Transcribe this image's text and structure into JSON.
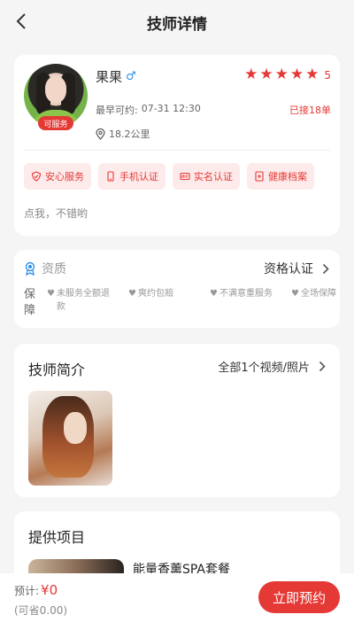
{
  "header": {
    "title": "技师详情"
  },
  "profile": {
    "name": "果果",
    "gender_symbol": "♂",
    "rating": 5,
    "rating_label": "5",
    "service_tag": "可服务",
    "available_label": "最早可约:",
    "available_time": "07-31 12:30",
    "served": "已接18单",
    "distance": "18.2公里",
    "badges": [
      "安心服务",
      "手机认证",
      "实名认证",
      "健康档案"
    ],
    "tagline": "点我，不错哟"
  },
  "qualification": {
    "title": "资质",
    "cert": "资格认证",
    "guarantee_label": "保障",
    "guarantees": [
      "未服务全额退款",
      "爽约包赔",
      "不满意重服务",
      "全场保障"
    ]
  },
  "intro": {
    "title": "技师简介",
    "more": "全部1个视频/照片"
  },
  "items": {
    "title": "提供项目",
    "first_item": "能量香薰SPA套餐"
  },
  "bottom": {
    "total_label": "预计:",
    "total_price": "¥0",
    "saved": "(可省0.00)",
    "book": "立即预约"
  },
  "colors": {
    "accent": "#e53935",
    "gender": "#2f8fe8"
  },
  "icons": [
    "back-icon",
    "star-icon",
    "location-icon",
    "shield-icon",
    "phone-icon",
    "id-card-icon",
    "health-record-icon",
    "medal-icon",
    "chevron-right-icon",
    "heart-icon"
  ]
}
